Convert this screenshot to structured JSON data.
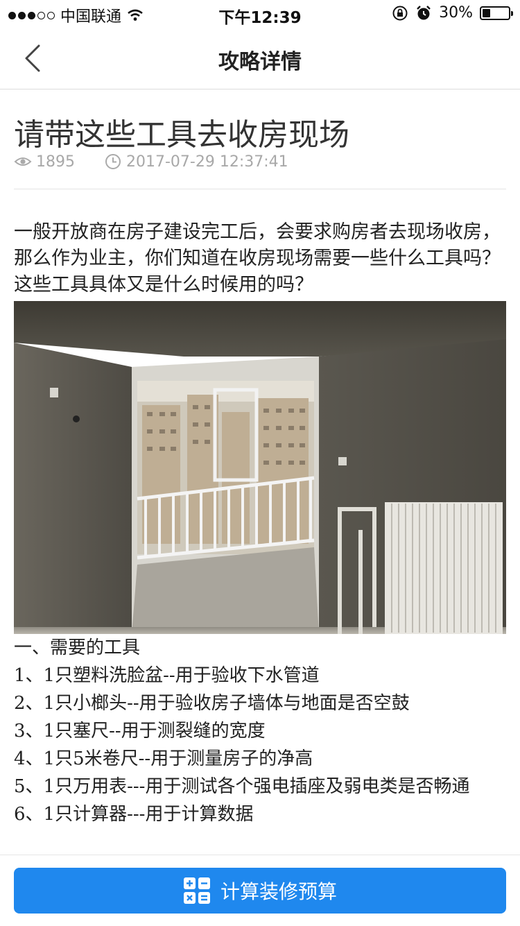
{
  "status_bar": {
    "carrier": "中国联通",
    "time": "下午12:39",
    "battery": "30%",
    "battery_level": 0.3
  },
  "nav": {
    "title": "攻略详情",
    "back_icon": "chevron-left-icon"
  },
  "article": {
    "title": "请带这些工具去收房现场",
    "views": "1895",
    "datetime": "2017-07-29 12:37:41",
    "intro": "一般开放商在房子建设完工后，会要求购房者去现场收房，那么作为业主，你们知道在收房现场需要一些什么工具吗？这些工具具体又是什么时候用的吗？",
    "list": [
      "一、需要的工具",
      "1、1只塑料洗脸盆--用于验收下水管道",
      "2、1只小榔头--用于验收房子墙体与地面是否空鼓",
      "3、1只塞尺--用于测裂缝的宽度",
      "4、1只5米卷尺--用于测量房子的净高",
      "5、1只万用表---用于测试各个强电插座及弱电类是否畅通",
      "6、1只计算器---用于计算数据"
    ]
  },
  "bottom": {
    "button_label": "计算装修预算",
    "accent_color": "#1f88ee"
  }
}
